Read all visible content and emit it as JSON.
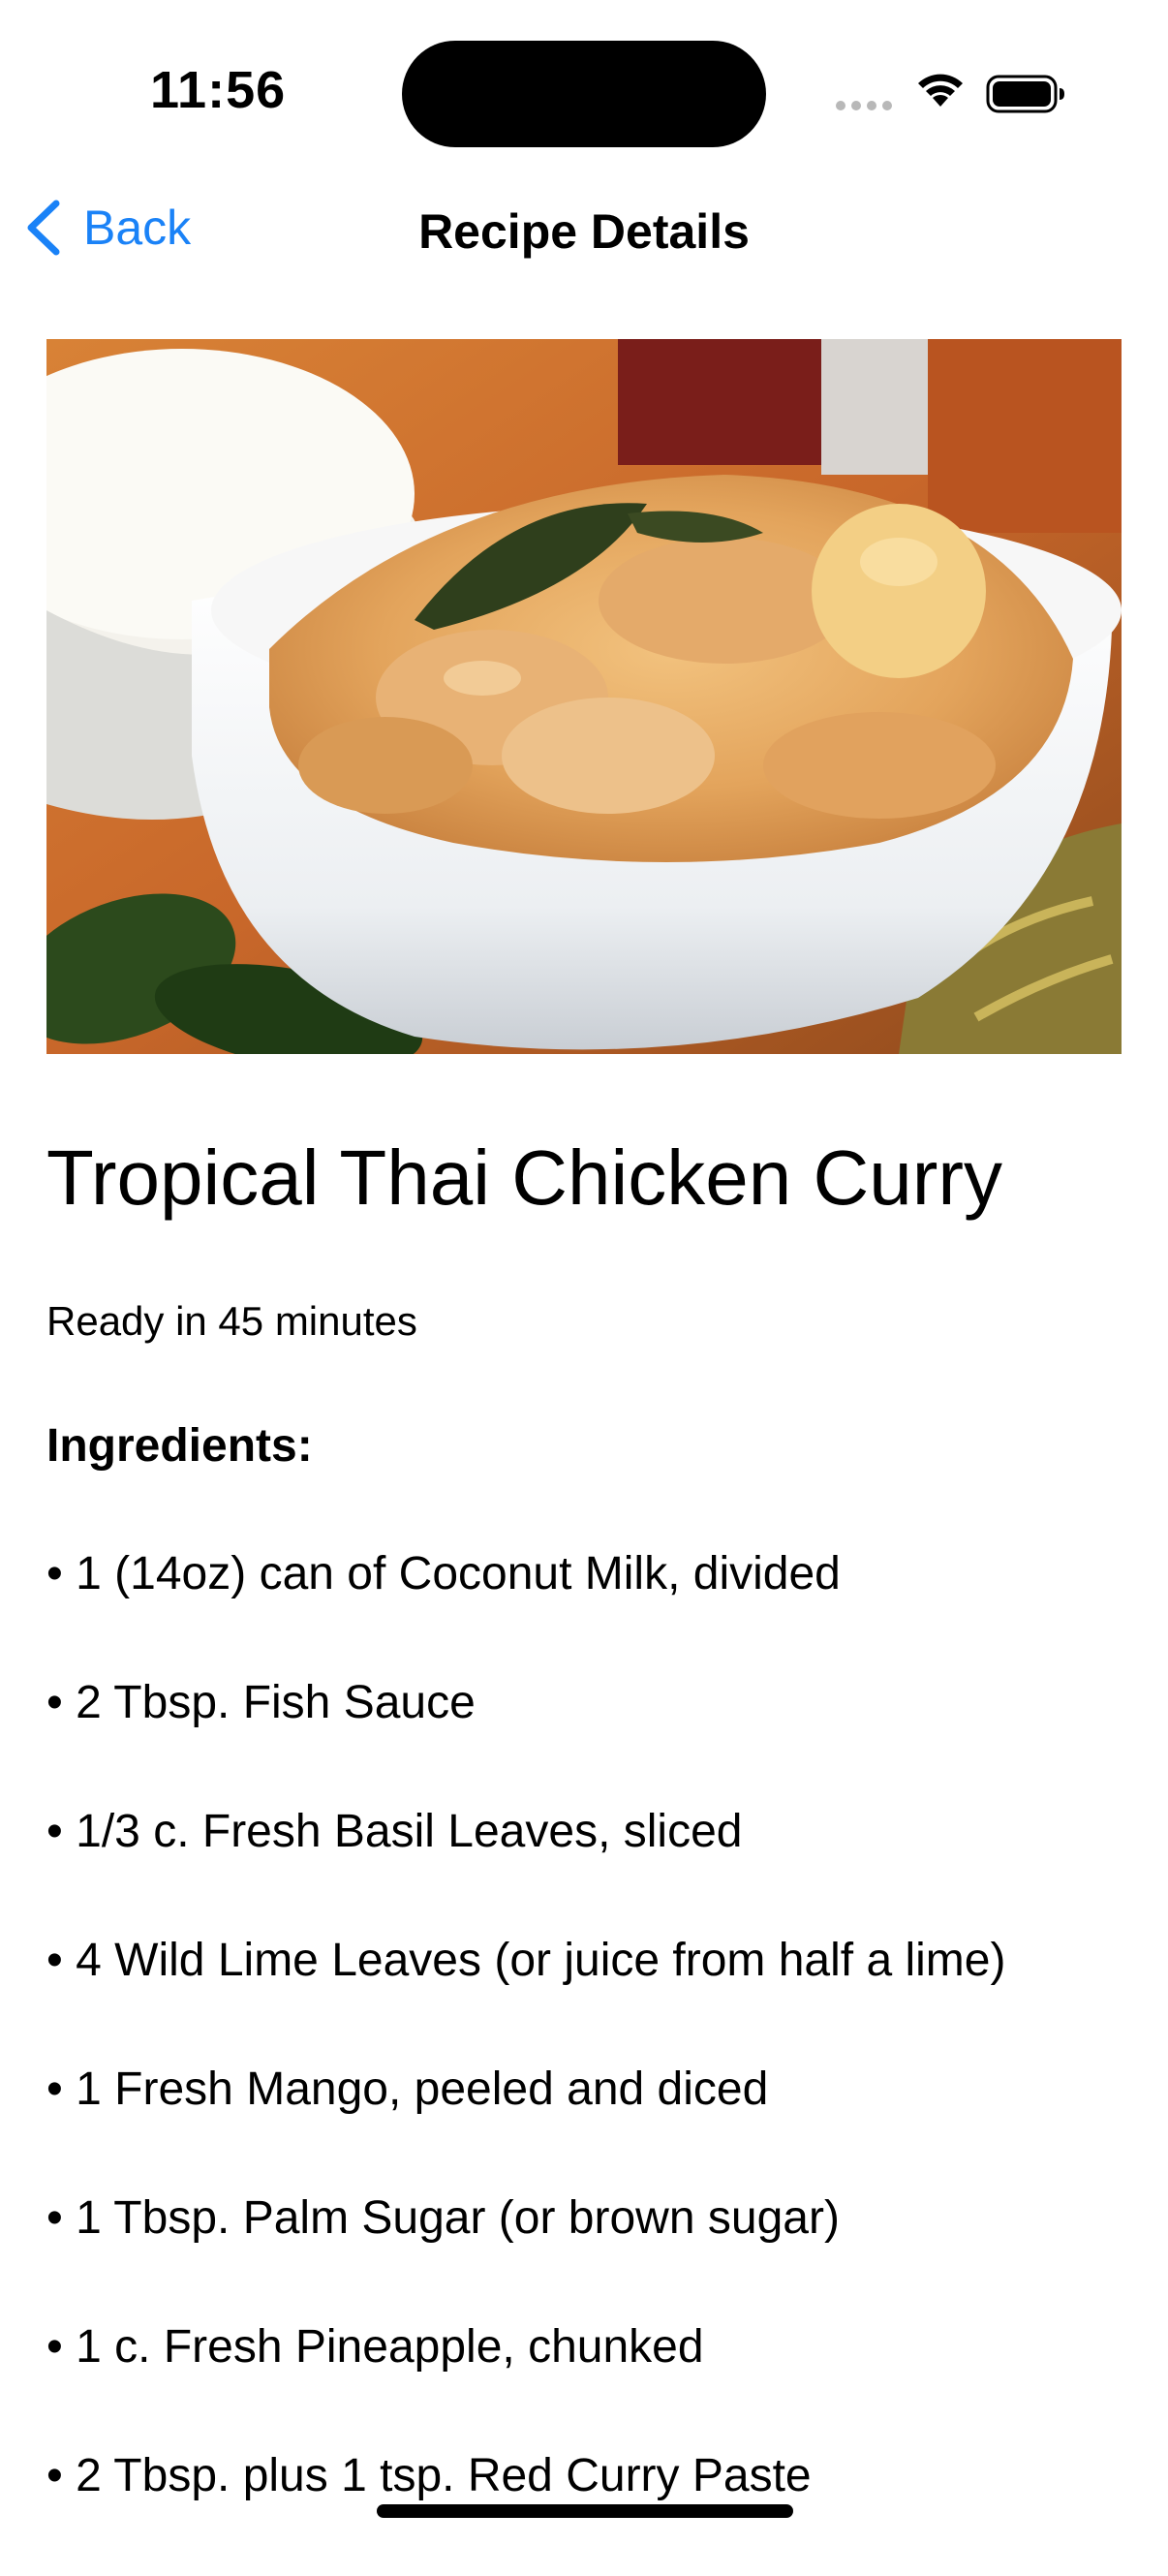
{
  "status_bar": {
    "time": "11:56",
    "icons": [
      "cellular-signal-icon",
      "wifi-icon",
      "battery-icon"
    ]
  },
  "nav": {
    "back_label": "Back",
    "back_icon": "chevron-left-icon",
    "title": "Recipe Details"
  },
  "colors": {
    "accent": "#1a82f7",
    "text": "#000000",
    "background": "#ffffff"
  },
  "recipe": {
    "image_alt": "Bowl of curry",
    "title": "Tropical Thai Chicken Curry",
    "ready_in": "Ready in 45 minutes",
    "ingredients_heading": "Ingredients:",
    "ingredients": [
      "• 1 (14oz) can of Coconut Milk, divided",
      "• 2 Tbsp. Fish Sauce",
      "• 1/3 c. Fresh Basil Leaves, sliced",
      "• 4 Wild Lime Leaves (or juice from half a lime)",
      "• 1 Fresh Mango, peeled and diced",
      "• 1 Tbsp. Palm Sugar (or brown sugar)",
      "• 1 c. Fresh Pineapple, chunked",
      "• 2 Tbsp. plus 1 tsp. Red Curry Paste"
    ]
  }
}
